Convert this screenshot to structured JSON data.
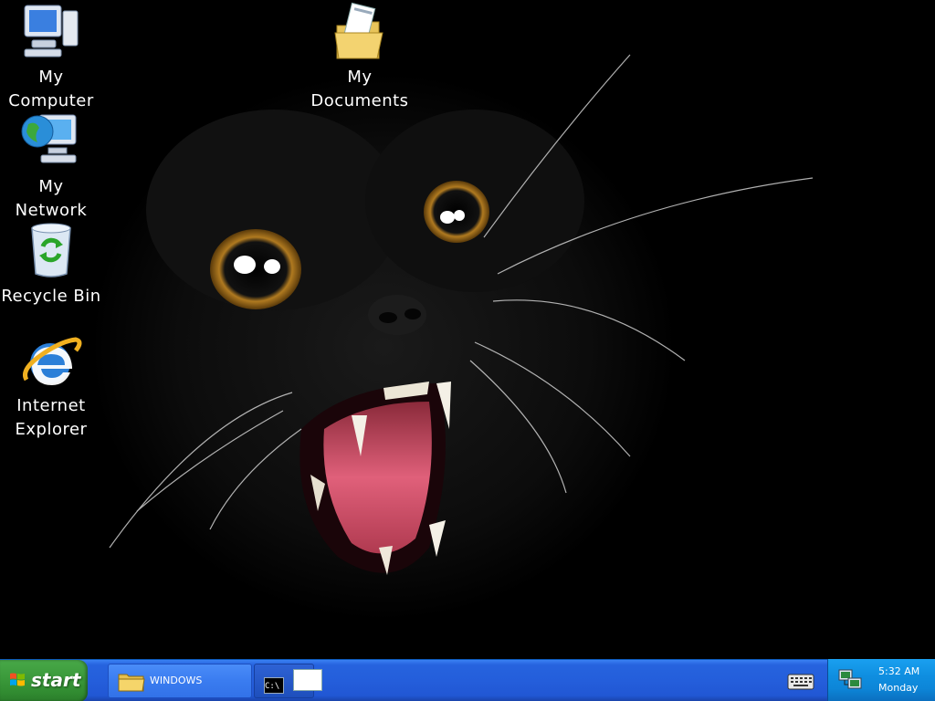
{
  "desktop": {
    "icons": [
      {
        "label": "My\nComputer",
        "icon": "my-computer-icon"
      },
      {
        "label": "My\nDocuments",
        "icon": "my-documents-icon"
      },
      {
        "label": "My\nNetwork Pl...",
        "icon": "network-places-icon"
      },
      {
        "label": "Recycle Bin",
        "icon": "recycle-bin-icon"
      },
      {
        "label": "Internet\nExplorer",
        "icon": "internet-explorer-icon"
      }
    ]
  },
  "taskbar": {
    "start_label": "start",
    "tasks": [
      {
        "label": "WINDOWS",
        "icon": "folder-icon"
      },
      {
        "label": "C:\\",
        "icon": "command-prompt-icon"
      }
    ],
    "tray": {
      "time": "5:32 AM",
      "day": "Monday"
    }
  },
  "colors": {
    "taskbar": "#245edb",
    "start_button": "#3c9b3c",
    "tray": "#0f8ee0"
  }
}
